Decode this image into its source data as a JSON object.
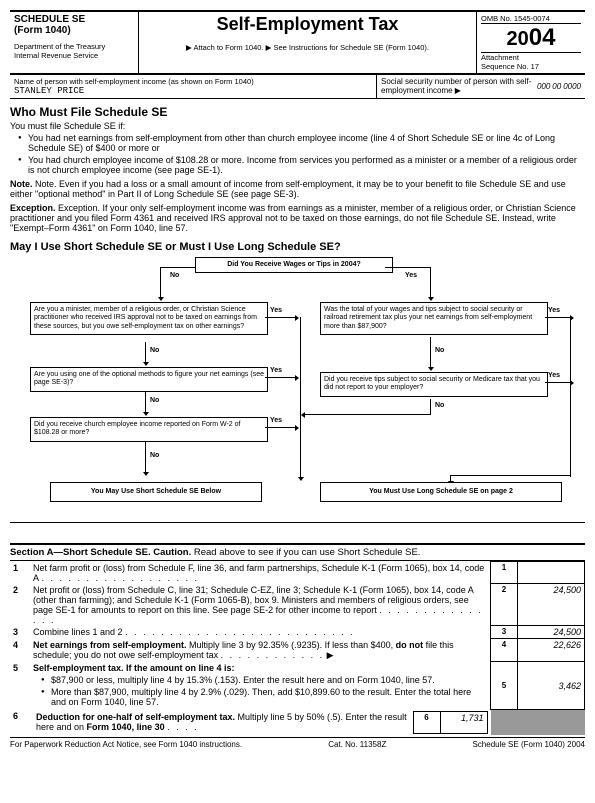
{
  "header": {
    "schedule": "SCHEDULE SE",
    "form": "(Form 1040)",
    "dept": "Department of the Treasury",
    "irs": "Internal Revenue Service",
    "title": "Self-Employment Tax",
    "attach": "▶ Attach to Form 1040. ▶ See Instructions for Schedule SE (Form 1040).",
    "omb": "OMB No. 1545-0074",
    "year_prefix": "20",
    "year_suffix": "04",
    "seq_label": "Attachment",
    "seq": "Sequence No. 17"
  },
  "name_row": {
    "label": "Name of person with self-employment income (as shown on Form 1040)",
    "value": "STANLEY PRICE",
    "ssn_label": "Social security number of person with self-employment income ▶",
    "ssn1": "000",
    "ssn2": "00",
    "ssn3": "0000"
  },
  "who": {
    "title": "Who Must File Schedule SE",
    "intro": "You must file Schedule SE if:",
    "b1": "You had net earnings from self-employment from other than church employee income (line 4 of Short Schedule SE or line 4c of Long Schedule SE) of $400 or more or",
    "b2": "You had church employee income of $108.28 or more. Income from services you performed as a minister or a member of a religious order is not church employee income (see page SE-1).",
    "note": "Note. Even if you had a loss or a small amount of income from self-employment, it may be to your benefit to file Schedule SE and use either \"optional method\" in Part II of Long Schedule SE (see page SE-3).",
    "exception": "Exception. If your only self-employment income was from earnings as a minister, member of a religious order, or Christian Science practitioner and you filed Form 4361 and received IRS approval not to be taxed on those earnings, do not file Schedule SE. Instead, write \"Exempt–Form 4361\" on Form 1040, line 57."
  },
  "choose": {
    "title": "May I Use Short Schedule SE or Must I Use Long Schedule SE?",
    "q_top": "Did You Receive Wages or Tips in 2004?",
    "no": "No",
    "yes": "Yes",
    "l1": "Are you a minister, member of a religious order, or Christian Science practitioner who received IRS approval not to be taxed on earnings from these sources, but you owe self-employment tax on other earnings?",
    "l2": "Are you using one of the optional methods to figure your net earnings (see page SE-3)?",
    "l3": "Did you receive church employee income reported on Form W-2 of $108.28 or more?",
    "r1": "Was the total of your wages and tips subject to social security or railroad retirement tax plus your net earnings from self-employment more than $87,900?",
    "r2": "Did you receive tips subject to social security or Medicare tax that you did not report to your employer?",
    "short": "You May Use Short Schedule SE Below",
    "long": "You Must Use Long Schedule SE on page 2"
  },
  "sectionA": {
    "bar": "Section A—Short Schedule SE. Caution. Read above to see if you can use Short Schedule SE.",
    "l1": "Net farm profit or (loss) from Schedule F, line 36, and farm partnerships, Schedule K-1 (Form 1065), box 14, code A",
    "l2": "Net profit or (loss) from Schedule C, line 31; Schedule C-EZ, line 3; Schedule K-1 (Form 1065), box 14, code A (other than farming); and Schedule K-1 (Form 1065-B), box 9. Ministers and members of religious orders, see page SE-1 for amounts to report on this line. See page SE-2 for other income to report",
    "l3": "Combine lines 1 and 2",
    "l4": "Net earnings from self-employment. Multiply line 3 by 92.35% (.9235). If less than $400, do not file this schedule; you do not owe self-employment tax",
    "l5": "Self-employment tax. If the amount on line 4 is:",
    "l5a": "$87,900 or less, multiply line 4 by 15.3% (.153). Enter the result here and on Form 1040, line 57.",
    "l5b": "More than $87,900, multiply line 4 by 2.9% (.029). Then, add $10,899.60 to the result. Enter the total here and on Form 1040, line 57.",
    "l6": "Deduction for one-half of self-employment tax. Multiply line 5 by 50% (.5). Enter the result here and on Form 1040, line 30",
    "v2": "24,500",
    "v3": "24,500",
    "v4": "22,626",
    "v5": "3,462",
    "v6": "1,731",
    "n1": "1",
    "n2": "2",
    "n3": "3",
    "n4": "4",
    "n5": "5",
    "n6": "6"
  },
  "footer": {
    "left": "For Paperwork Reduction Act Notice, see Form 1040 instructions.",
    "mid": "Cat. No. 11358Z",
    "right": "Schedule SE (Form 1040) 2004"
  }
}
